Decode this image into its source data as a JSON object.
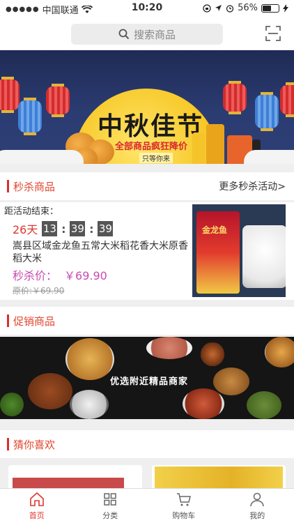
{
  "status_bar": {
    "carrier": "中国联通",
    "time": "10:20",
    "battery": "56%",
    "battery_level": 0.56
  },
  "search": {
    "placeholder": "搜索商品",
    "icon": "search-icon",
    "scan_icon": "scan-icon"
  },
  "banner": {
    "title": "中秋佳节",
    "subtitle": "全部商品疯狂降价",
    "tagline": "只等你来"
  },
  "flash_sale": {
    "section_title": "秒杀商品",
    "more_link": "更多秒杀活动>",
    "countdown_label": "距活动结束：",
    "days": "26天",
    "hours": "13",
    "minutes": "39",
    "seconds": "39",
    "product_name": "嵩县区域金龙鱼五常大米稻花香大米原香稻大米",
    "price_label": "秒杀价：",
    "price": "￥69.90",
    "original_price": "原价:￥69.90",
    "image_brand": "金龙鱼"
  },
  "promo": {
    "section_title": "促销商品",
    "banner_text": "优选附近精品商家"
  },
  "guess": {
    "section_title": "猜你喜欢"
  },
  "tabbar": {
    "items": [
      {
        "label": "首页",
        "icon": "home-icon",
        "active": true
      },
      {
        "label": "分类",
        "icon": "grid-icon",
        "active": false
      },
      {
        "label": "购物车",
        "icon": "cart-icon",
        "active": false
      },
      {
        "label": "我的",
        "icon": "user-icon",
        "active": false
      }
    ]
  },
  "colors": {
    "accent": "#e0352f",
    "price": "#c94bb0",
    "section_bar": "#d62f2f"
  }
}
